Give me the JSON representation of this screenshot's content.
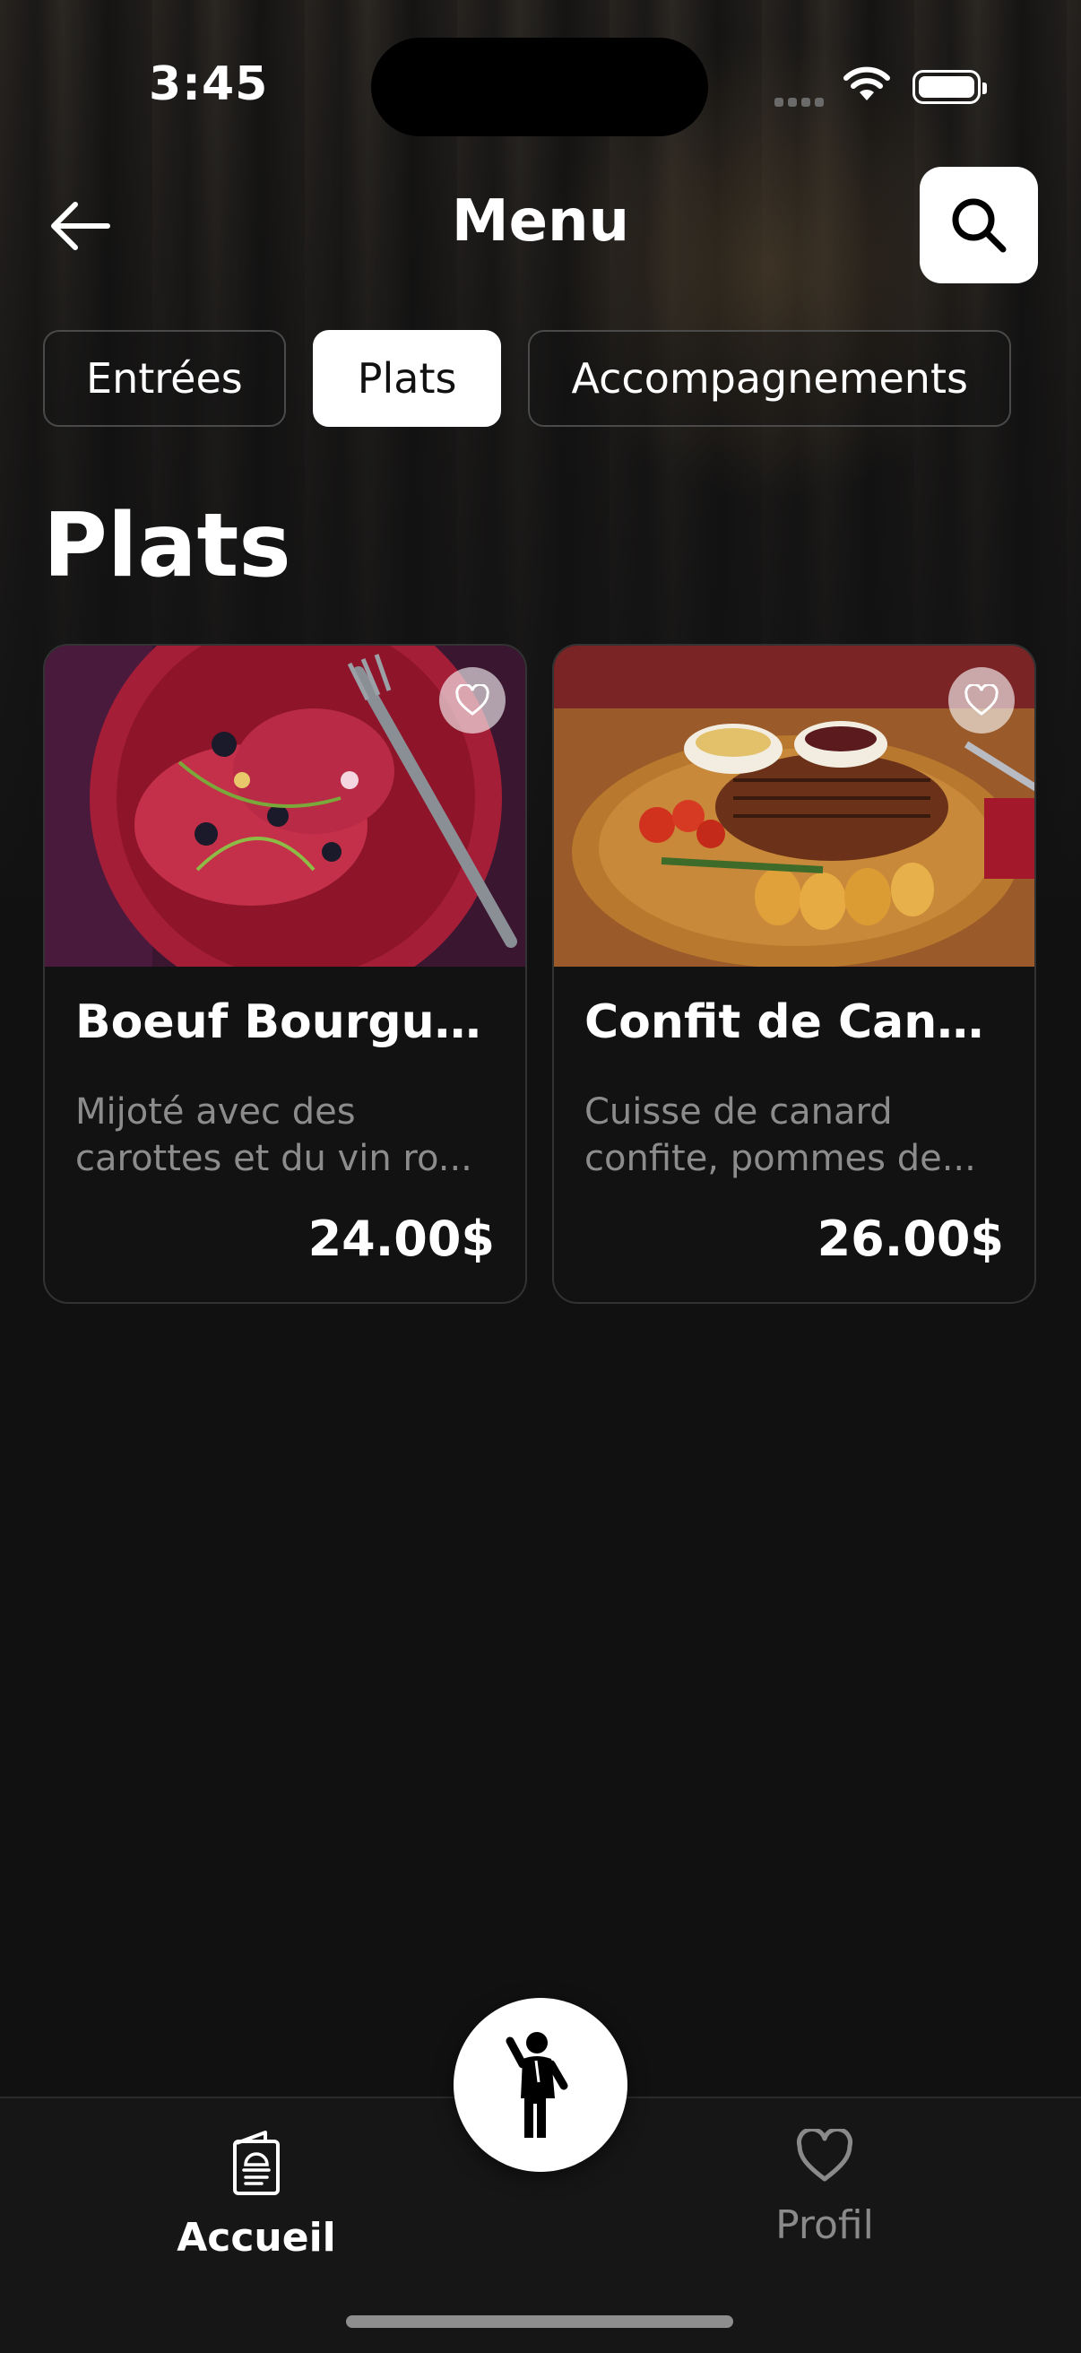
{
  "status_bar": {
    "time": "3:45"
  },
  "header": {
    "title": "Menu"
  },
  "tabs": [
    {
      "label": "Entrées",
      "active": false
    },
    {
      "label": "Plats",
      "active": true
    },
    {
      "label": "Accompagnements",
      "active": false
    }
  ],
  "section": {
    "title": "Plats"
  },
  "dishes": [
    {
      "name": "Boeuf Bourgui...",
      "description": "Mijoté avec des carottes et du vin ro...",
      "price": "24.00$"
    },
    {
      "name": "Confit de Cana...",
      "description": "Cuisse de canard confite, pommes de...",
      "price": "26.00$"
    }
  ],
  "bottom_nav": {
    "home_label": "Accueil",
    "profile_label": "Profil"
  },
  "icons": {
    "back": "arrow-left-icon",
    "search": "search-icon",
    "favorite": "heart-icon",
    "home": "menu-book-icon",
    "profile": "heart-icon",
    "call_waiter": "waiter-icon"
  },
  "colors": {
    "background": "#111112",
    "accent": "#ffffff",
    "muted": "#8c8c8c"
  }
}
